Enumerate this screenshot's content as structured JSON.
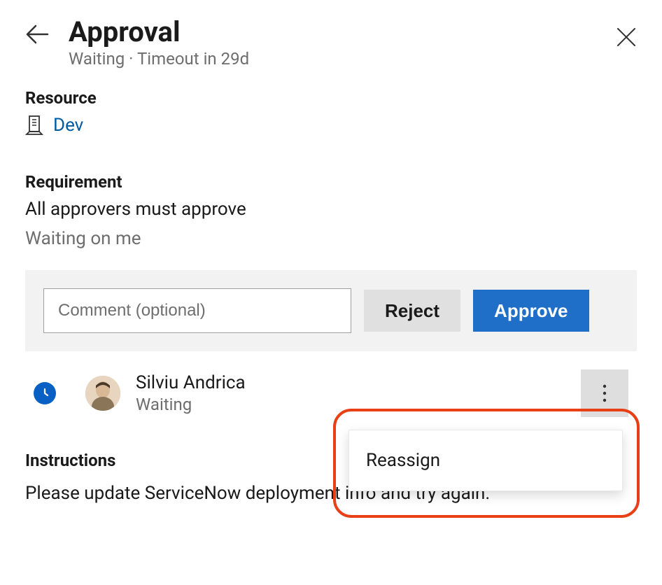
{
  "header": {
    "title": "Approval",
    "status": "Waiting",
    "separator": " · ",
    "timeout": "Timeout in 29d"
  },
  "resource": {
    "heading": "Resource",
    "name": "Dev"
  },
  "requirement": {
    "heading": "Requirement",
    "text": "All approvers must approve",
    "waiting": "Waiting on me"
  },
  "actions": {
    "comment_placeholder": "Comment (optional)",
    "reject_label": "Reject",
    "approve_label": "Approve"
  },
  "approver": {
    "name": "Silviu Andrica",
    "status": "Waiting"
  },
  "popover": {
    "reassign": "Reassign"
  },
  "instructions": {
    "heading": "Instructions",
    "text": "Please update ServiceNow deployment info and try again."
  }
}
